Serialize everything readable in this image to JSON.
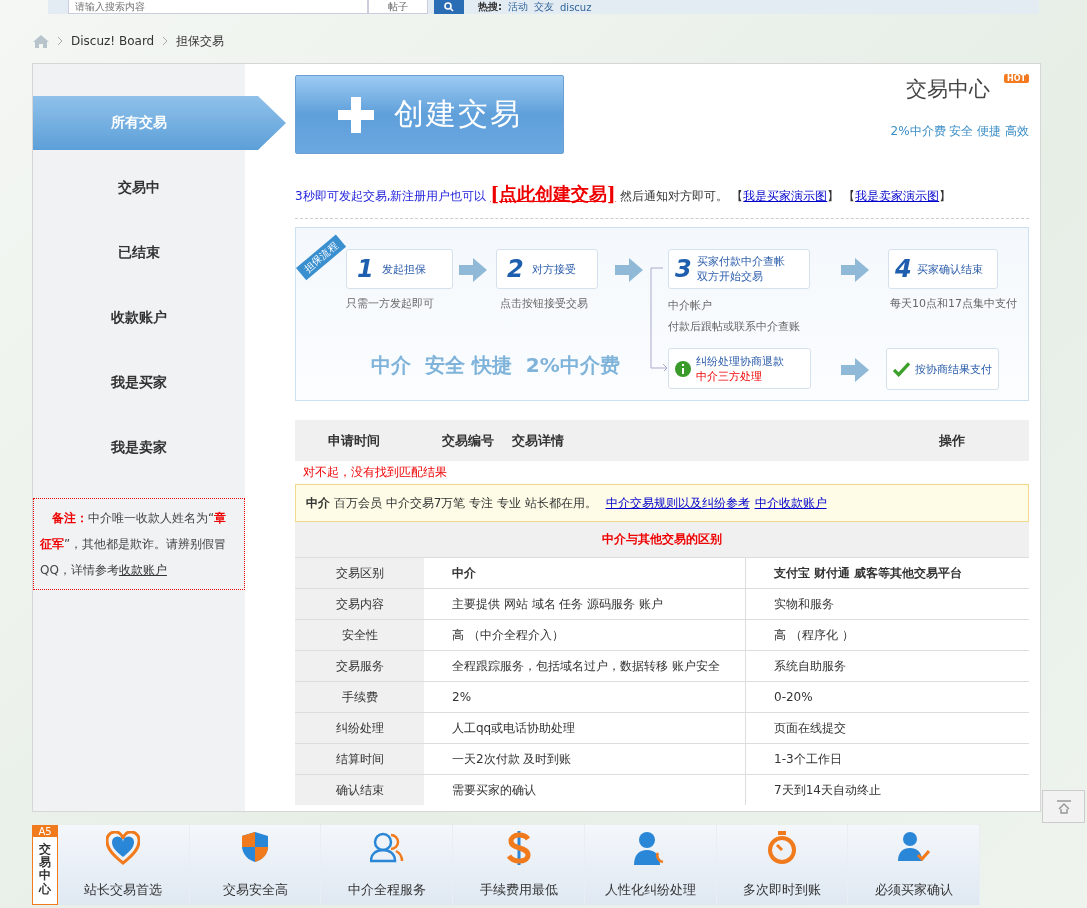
{
  "search_bar": {
    "placeholder": "请输入搜索内容",
    "scope": "帖子",
    "hot_label": "热搜:",
    "hot_links": [
      "活动",
      "交友",
      "discuz"
    ]
  },
  "breadcrumb": [
    "Discuz! Board",
    "担保交易"
  ],
  "sidebar": {
    "items": [
      {
        "label": "所有交易",
        "selected": true
      },
      {
        "label": "交易中",
        "selected": false
      },
      {
        "label": "已结束",
        "selected": false
      },
      {
        "label": "收款账户",
        "selected": false
      },
      {
        "label": "我是买家",
        "selected": false
      },
      {
        "label": "我是卖家",
        "selected": false
      }
    ],
    "notice": {
      "label": "备注：",
      "before": "中介唯一收款人姓名为“",
      "name": "章征军",
      "after": "”，其他都是欺诈。请辨别假冒QQ，详情参考",
      "link": "收款账户"
    }
  },
  "create_button": "创建交易",
  "logo": {
    "title": "交易中心",
    "badge": "HOT",
    "tagline": "2%中介费 安全 便捷 高效"
  },
  "intro": [
    {
      "kind": "text",
      "text": "3秒即可发起交易,新注册用户也可以"
    },
    {
      "kind": "cta",
      "text": "[点此创建交易]"
    },
    {
      "kind": "plain",
      "text": "然后通知对方即可。 【"
    },
    {
      "kind": "link",
      "text": "我是买家演示图"
    },
    {
      "kind": "plain",
      "text": "】 【"
    },
    {
      "kind": "link",
      "text": "我是卖家演示图"
    },
    {
      "kind": "plain",
      "text": "】"
    }
  ],
  "flow": {
    "ribbon": "担保流程",
    "steps": [
      {
        "num": "1",
        "title": [
          "发起担保"
        ],
        "note": [
          "只需一方发起即可"
        ]
      },
      {
        "num": "2",
        "title": [
          "对方接受"
        ],
        "note": [
          "点击按钮接受交易"
        ]
      },
      {
        "num": "3",
        "title": [
          "买家付款中介查帐",
          "双方开始交易"
        ],
        "note": [
          "中介帐户",
          "付款后跟帖或联系中介查账"
        ]
      },
      {
        "num": "4",
        "title": [
          "买家确认结束"
        ],
        "note": [
          "每天10点和17点集中支付"
        ]
      }
    ],
    "dispute": [
      "纠纷处理协商退款",
      "中介三方处理"
    ],
    "resolve": "按协商结果支付",
    "slogan": "中介  安全 快捷  2%中介费"
  },
  "records": {
    "columns": [
      "申请时间",
      "交易编号",
      "交易详情",
      "操作"
    ],
    "empty": "对不起，没有找到匹配结果"
  },
  "info_bar": {
    "strong": "中介",
    "text": "百万会员 中介交易7万笔 专注 专业 站长都在用。",
    "links": [
      "中介交易规则以及纠纷参考",
      "中介收款账户"
    ]
  },
  "compare": {
    "title": "中介与其他交易的区别",
    "header": [
      "交易区别",
      "中介",
      "支付宝 财付通 威客等其他交易平台"
    ],
    "rows": [
      [
        "交易内容",
        "主要提供 网站 域名 任务 源码服务 账户",
        "实物和服务"
      ],
      [
        "安全性",
        "高 （中介全程介入）",
        "高 （程序化 ）"
      ],
      [
        "交易服务",
        "全程跟踪服务，包括域名过户，数据转移 账户安全",
        "系统自助服务"
      ],
      [
        "手续费",
        "2%",
        "0-20%"
      ],
      [
        "纠纷处理",
        "人工qq或电话协助处理",
        "页面在线提交"
      ],
      [
        "结算时间",
        "一天2次付款 及时到账",
        "1-3个工作日"
      ],
      [
        "确认结束",
        "需要买家的确认",
        "7天到14天自动终止"
      ]
    ]
  },
  "footer": {
    "badge": "A5",
    "title": "交易中心",
    "items": [
      "站长交易首选",
      "交易安全高",
      "中介全程服务",
      "手续费用最低",
      "人性化纠纷处理",
      "多次即时到账",
      "必须买家确认"
    ]
  }
}
